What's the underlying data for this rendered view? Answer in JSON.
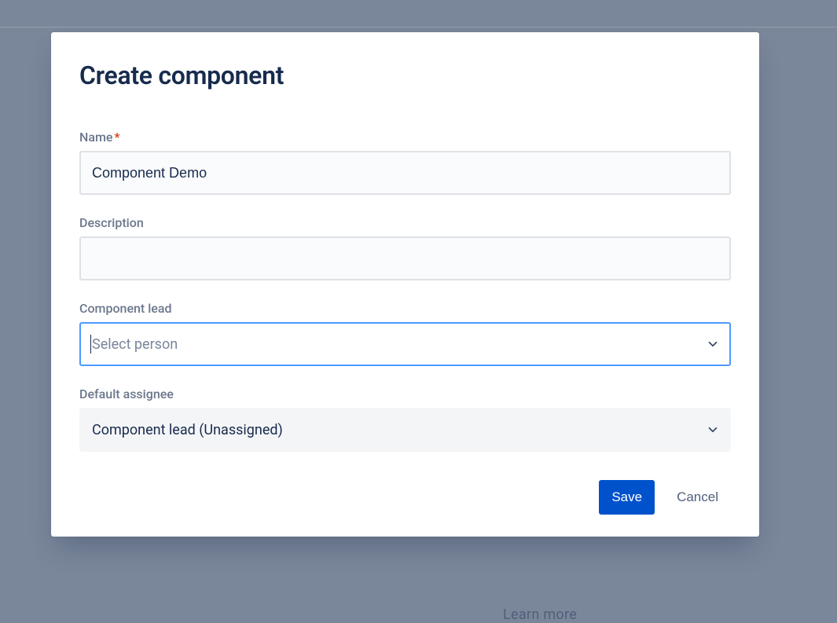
{
  "modal": {
    "title": "Create component",
    "fields": {
      "name": {
        "label": "Name",
        "required": true,
        "value": "Component Demo"
      },
      "description": {
        "label": "Description",
        "value": ""
      },
      "componentLead": {
        "label": "Component lead",
        "placeholder": "Select person",
        "value": ""
      },
      "defaultAssignee": {
        "label": "Default assignee",
        "value": "Component lead (Unassigned)"
      }
    },
    "buttons": {
      "save": "Save",
      "cancel": "Cancel"
    }
  },
  "background": {
    "learnMore": "Learn more"
  }
}
